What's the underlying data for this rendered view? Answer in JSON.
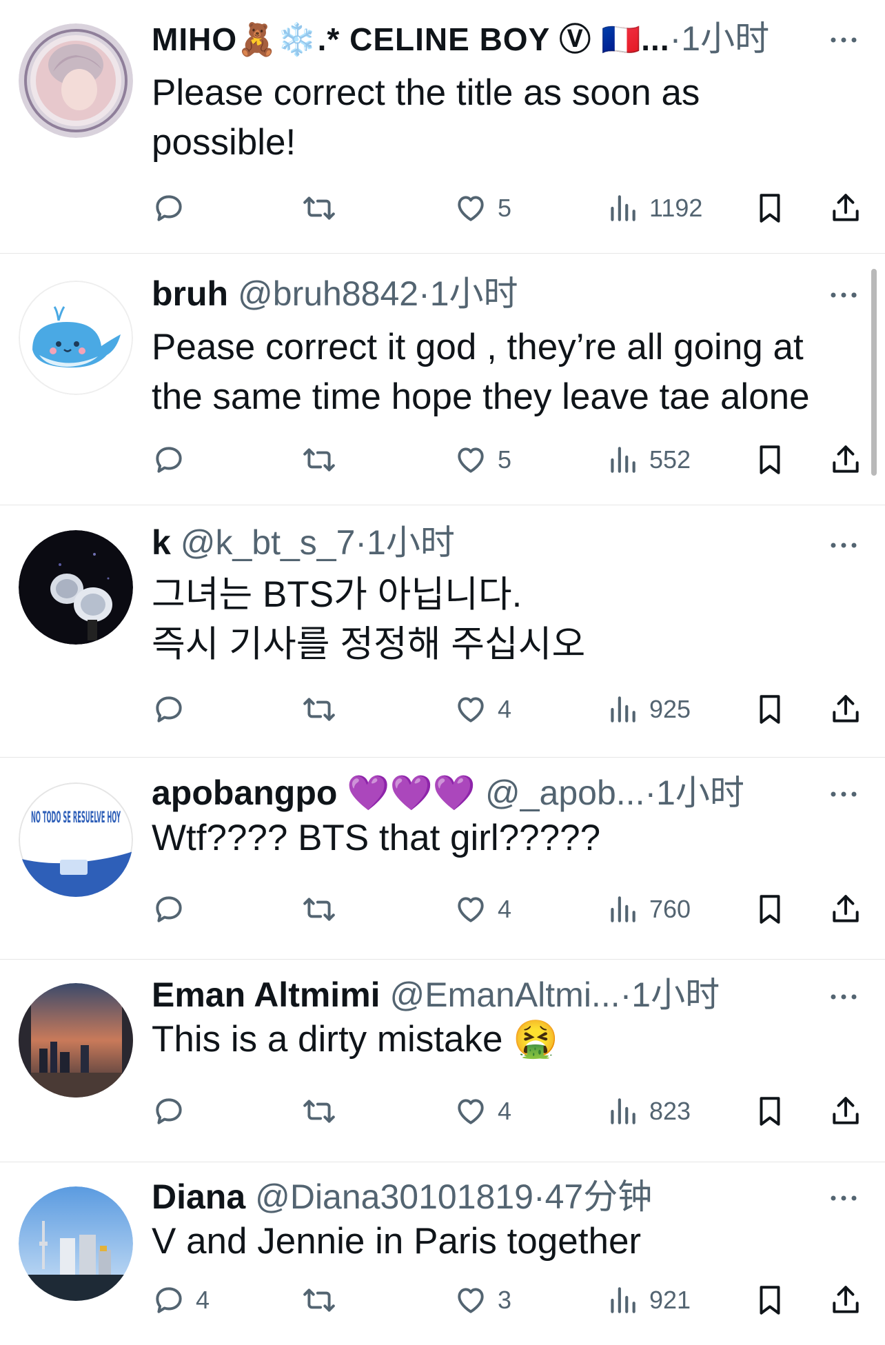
{
  "posts": [
    {
      "name": "MIHO🧸❄️.* CELINE BOY Ⓥ 🇫🇷...",
      "handle": "",
      "time": "1小时",
      "text": "Please correct the title as soon as\npossible!",
      "reply_count": "",
      "like_count": "5",
      "view_count": "1192"
    },
    {
      "name": "bruh",
      "handle": "@bruh8842",
      "time": "1小时",
      "text": "Pease correct it god , they’re all going at\nthe same time hope they leave tae alone",
      "reply_count": "",
      "like_count": "5",
      "view_count": "552"
    },
    {
      "name": "k",
      "handle": "@k_bt_s_7",
      "time": "1小时",
      "text": "그녀는 BTS가 아닙니다.\n즉시 기사를 정정해 주십시오",
      "reply_count": "",
      "like_count": "4",
      "view_count": "925"
    },
    {
      "name": "apobangpo 💜💜💜",
      "handle": "@_apob...",
      "time": "1小时",
      "text": "Wtf???? BTS that girl?????",
      "reply_count": "",
      "like_count": "4",
      "view_count": "760"
    },
    {
      "name": "Eman Altmimi",
      "handle": "@EmanAltmi...",
      "time": "1小时",
      "text": "This is a dirty mistake 🤮",
      "reply_count": "",
      "like_count": "4",
      "view_count": "823"
    },
    {
      "name": "Diana",
      "handle": "@Diana30101819",
      "time": "47分钟",
      "text": "V and Jennie in Paris together",
      "reply_count": "4",
      "like_count": "3",
      "view_count": "921"
    }
  ],
  "avatar_4_text": "NO TODO SE RESUELVE HOY",
  "separator": "·",
  "colors": {
    "text": "#0f1419",
    "secondary": "#536471",
    "divider": "#e6e6e6",
    "scrollbar": "#b9b9b9"
  },
  "icons": [
    "reply-icon",
    "retweet-icon",
    "like-icon",
    "views-icon",
    "bookmark-icon",
    "share-icon",
    "more-icon"
  ]
}
